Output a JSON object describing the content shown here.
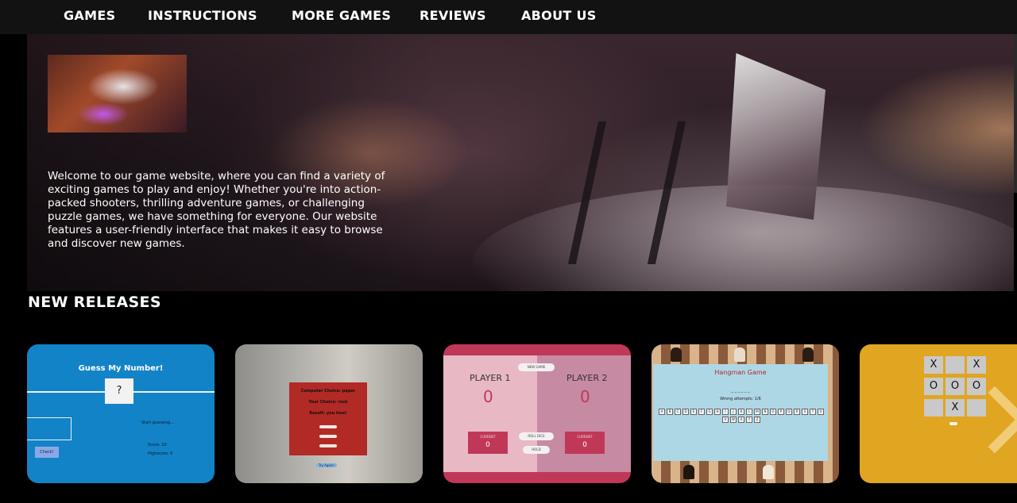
{
  "nav": {
    "items": [
      "GAMES",
      "INSTRUCTIONS",
      "MORE GAMES",
      "REVIEWS",
      "ABOUT US"
    ]
  },
  "hero": {
    "description": "Welcome to our game website, where you can find a variety of exciting games to play and enjoy! Whether you're into action-packed shooters, thrilling adventure games, or challenging puzzle games, we have something for everyone. Our website features a user-friendly interface that makes it easy to browse and discover new games."
  },
  "section": {
    "title": "NEW RELEASES"
  },
  "cards": {
    "guess": {
      "title": "Guess My Number!",
      "mystery": "?",
      "status": "Start guessing...",
      "check_label": "Check!",
      "score": "Score: 20",
      "highscore": "Highscore: 0"
    },
    "rps": {
      "computer": "Computer Choice: paper",
      "your": "Your Choice: rock",
      "result": "Result: you lose!",
      "play_again": "Try Again!"
    },
    "pig": {
      "new_game": "NEW GAME",
      "player1": "PLAYER 1",
      "player2": "PLAYER 2",
      "score1": "0",
      "score2": "0",
      "current_label": "CURRENT",
      "current1": "0",
      "current2": "0",
      "roll": "ROLL DICE",
      "hold": "HOLD"
    },
    "hangman": {
      "title": "Hangman Game",
      "blanks": "_ _ _ _ _ _",
      "attempts": "Wrong attempts: 1/6",
      "keys": [
        "A",
        "B",
        "C",
        "D",
        "E",
        "F",
        "G",
        "H",
        "I",
        "J",
        "K",
        "L",
        "M",
        "N",
        "O",
        "P",
        "Q",
        "R",
        "S",
        "T",
        "U",
        "V",
        "W",
        "X",
        "Y",
        "Z"
      ]
    },
    "tictactoe": {
      "board": [
        "X",
        "",
        "X",
        "O",
        "O",
        "O",
        "",
        "X",
        ""
      ]
    }
  },
  "colors": {
    "page_bg": "#000000",
    "nav_bg": "#121212",
    "card_blue": "#1383c7",
    "card_red": "#c03858",
    "card_gold": "#e0a521"
  }
}
